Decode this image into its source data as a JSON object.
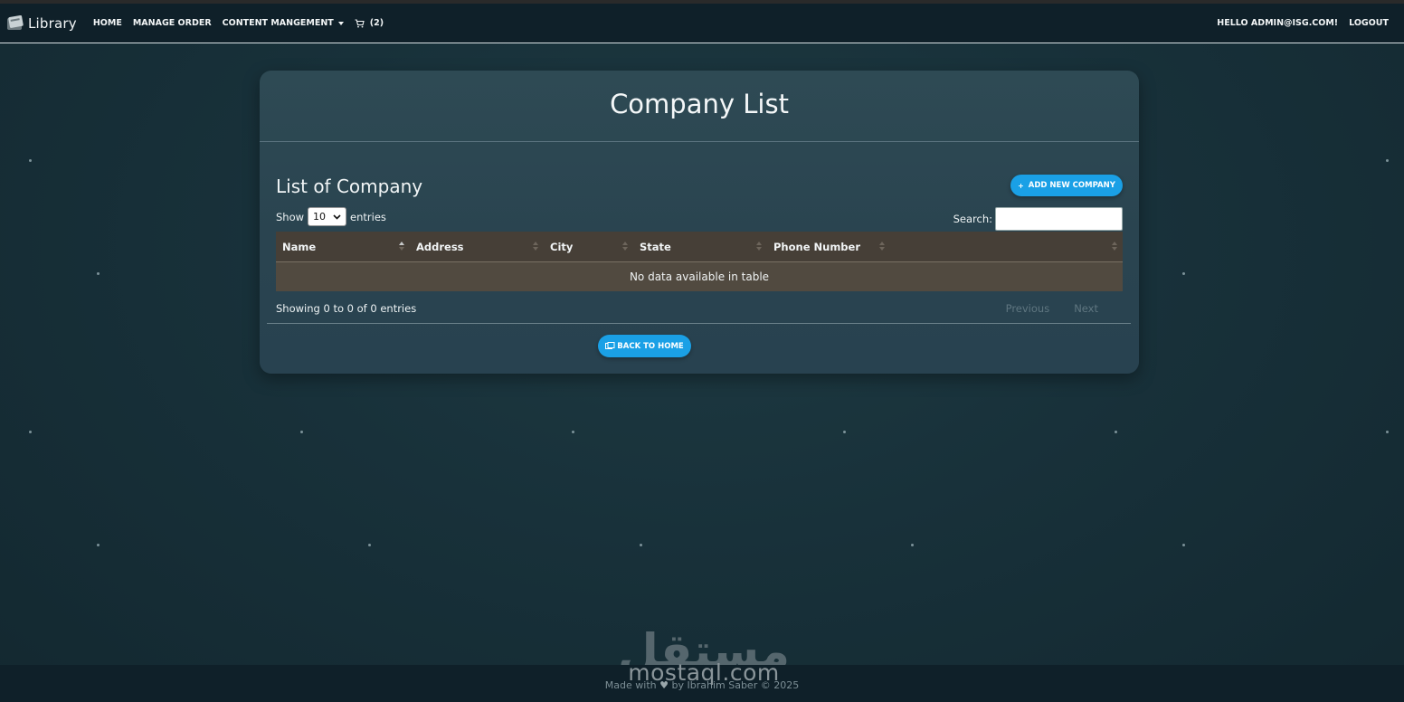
{
  "navbar": {
    "brand": "Library",
    "links": [
      "HOME",
      "MANAGE ORDER",
      "CONTENT MANGEMENT"
    ],
    "cart_count": "(2)",
    "greeting": "HELLO ADMIN@ISG.COM!",
    "logout": "LOGOUT"
  },
  "card": {
    "title": "Company List",
    "section_title": "List of Company",
    "add_button": "ADD NEW COMPANY",
    "show_label": "Show",
    "entries_select": "10",
    "entries_label": "entries",
    "search_label": "Search:",
    "search_value": "",
    "columns": [
      "Name",
      "Address",
      "City",
      "State",
      "Phone Number",
      ""
    ],
    "empty_message": "No data available in table",
    "info": "Showing 0 to 0 of 0 entries",
    "prev": "Previous",
    "next": "Next",
    "back_button": "BACK TO HOME"
  },
  "footer": {
    "text": "Made with",
    "by": "by Ibrahim Saber © 2025"
  },
  "watermark": {
    "latin": "mostaql.com"
  },
  "colors": {
    "accent": "#1aa0e6",
    "navbar": "#0f2029",
    "table_header": "#463f37",
    "table_row": "#514a40"
  }
}
